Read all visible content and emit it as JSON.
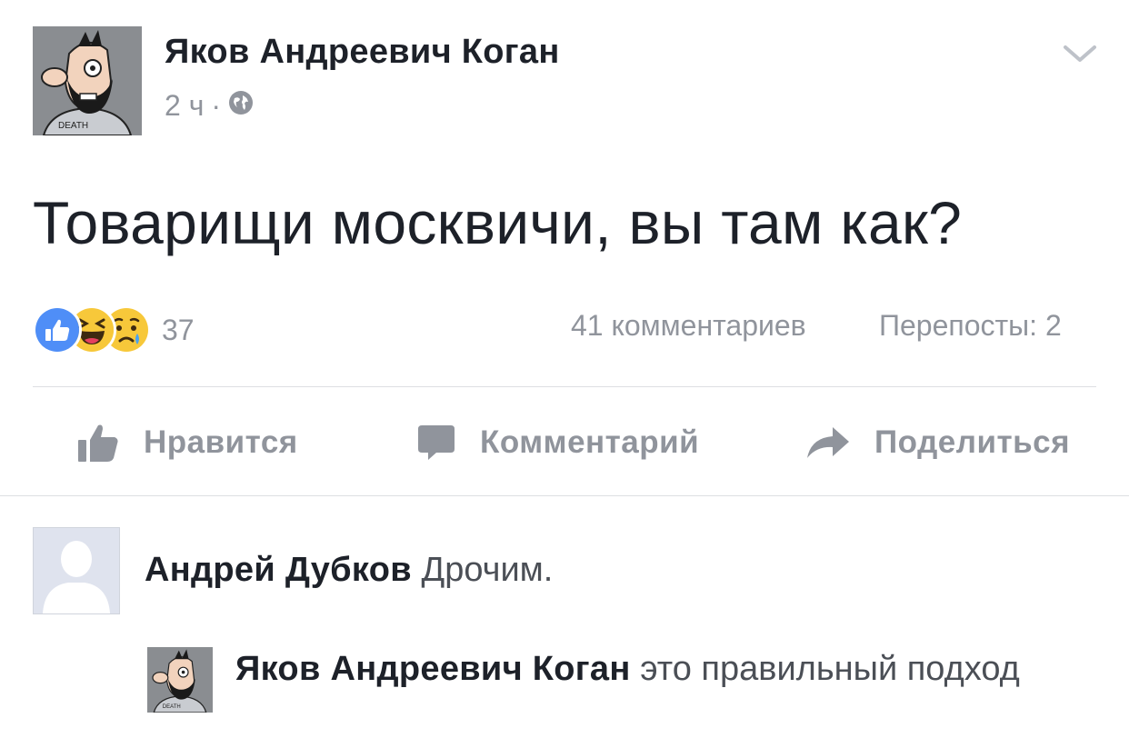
{
  "post": {
    "author": "Яков Андреевич Коган",
    "time": "2 ч",
    "separator": "·",
    "privacy_icon": "globe-icon",
    "text": "Товарищи москвичи, вы там как?",
    "avatar_caption": "DEATH"
  },
  "stats": {
    "reactions": [
      "like-reaction",
      "haha-reaction",
      "sad-reaction"
    ],
    "reaction_count": "37",
    "comments": "41 комментариев",
    "shares": "Перепосты: 2"
  },
  "actions": {
    "like": "Нравится",
    "comment": "Комментарий",
    "share": "Поделиться"
  },
  "comments": [
    {
      "author": "Андрей Дубков",
      "text": "Дрочим."
    }
  ],
  "replies": [
    {
      "author": "Яков Андреевич Коган",
      "text": "это правильный подход",
      "avatar_caption": "DEATH"
    }
  ],
  "colors": {
    "text_primary": "#1d2129",
    "text_secondary": "#90949c",
    "like_blue": "#4f8ef7",
    "reaction_yellow": "#f7c83a",
    "divider": "#dddfe2"
  }
}
